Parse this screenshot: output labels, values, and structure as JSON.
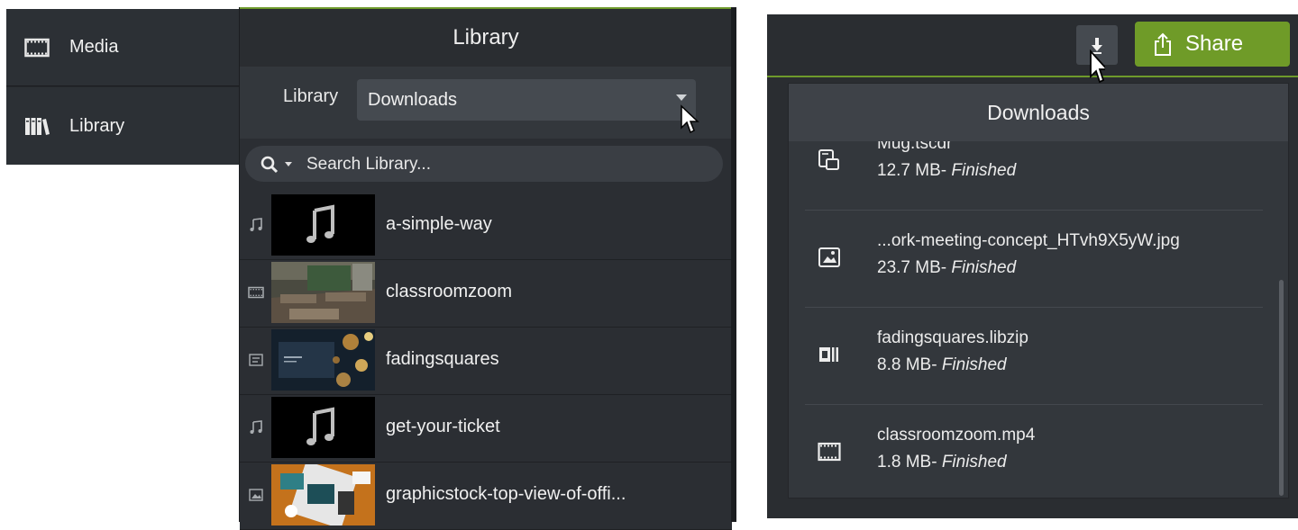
{
  "side_tabs": [
    {
      "label": "Media",
      "icon": "film-icon"
    },
    {
      "label": "Library",
      "icon": "books-icon"
    }
  ],
  "library": {
    "title": "Library",
    "selector_label": "Library",
    "selected": "Downloads",
    "search_placeholder": "Search Library...",
    "items": [
      {
        "name": "a-simple-way",
        "type": "audio",
        "type_icon": "music-note-icon",
        "thumb": "audio"
      },
      {
        "name": "classroomzoom",
        "type": "video",
        "type_icon": "film-icon",
        "thumb": "classroom"
      },
      {
        "name": "fadingsquares",
        "type": "title",
        "type_icon": "caption-icon",
        "thumb": "bokeh"
      },
      {
        "name": "get-your-ticket",
        "type": "audio",
        "type_icon": "music-note-icon",
        "thumb": "audio"
      },
      {
        "name": "graphicstock-top-view-of-offi...",
        "type": "image",
        "type_icon": "image-icon",
        "thumb": "office"
      }
    ]
  },
  "toolbar": {
    "download_icon": "download-arrow-icon",
    "share_label": "Share",
    "share_icon": "share-icon"
  },
  "downloads": {
    "title": "Downloads",
    "items": [
      {
        "file": "Mug.tscdr",
        "size": "12.7 MB",
        "separator": "- ",
        "status": "Finished",
        "icon": "device-icon"
      },
      {
        "file": "...ork-meeting-concept_HTvh9X5yW.jpg",
        "size": "23.7 MB",
        "separator": "- ",
        "status": "Finished",
        "icon": "image-icon"
      },
      {
        "file": "fadingsquares.libzip",
        "size": "8.8 MB",
        "separator": "- ",
        "status": "Finished",
        "icon": "library-asset-icon"
      },
      {
        "file": "classroomzoom.mp4",
        "size": "1.8 MB",
        "separator": "- ",
        "status": "Finished",
        "icon": "film-icon"
      }
    ]
  },
  "colors": {
    "accent_green": "#6f9b28",
    "panel_dark": "#2b2e33",
    "popup_bg": "#33373c"
  }
}
